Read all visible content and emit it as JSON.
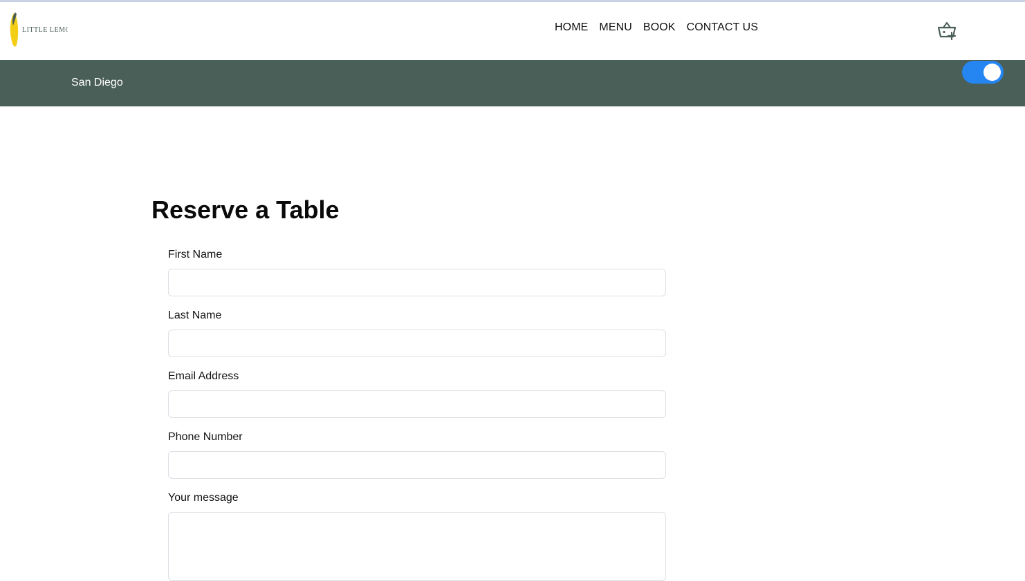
{
  "header": {
    "logo_text": "LITTLE LEMON",
    "nav": [
      {
        "label": "HOME"
      },
      {
        "label": "MENU"
      },
      {
        "label": "BOOK"
      },
      {
        "label": "CONTACT US"
      }
    ],
    "cart_icon": "basket-add-icon"
  },
  "banner": {
    "city": "San Diego",
    "toggle_on": true,
    "toggle_color": "#2586f2",
    "background": "#4b5f59"
  },
  "form": {
    "title": "Reserve a Table",
    "fields": [
      {
        "label": "First Name",
        "value": "",
        "placeholder": ""
      },
      {
        "label": "Last Name",
        "value": "",
        "placeholder": ""
      },
      {
        "label": "Email Address",
        "value": "",
        "placeholder": ""
      },
      {
        "label": "Phone Number",
        "value": "",
        "placeholder": ""
      }
    ],
    "message": {
      "label": "Your message",
      "value": "",
      "placeholder": ""
    }
  },
  "colors": {
    "brand_yellow": "#f4ce14",
    "brand_green": "#495e57"
  }
}
